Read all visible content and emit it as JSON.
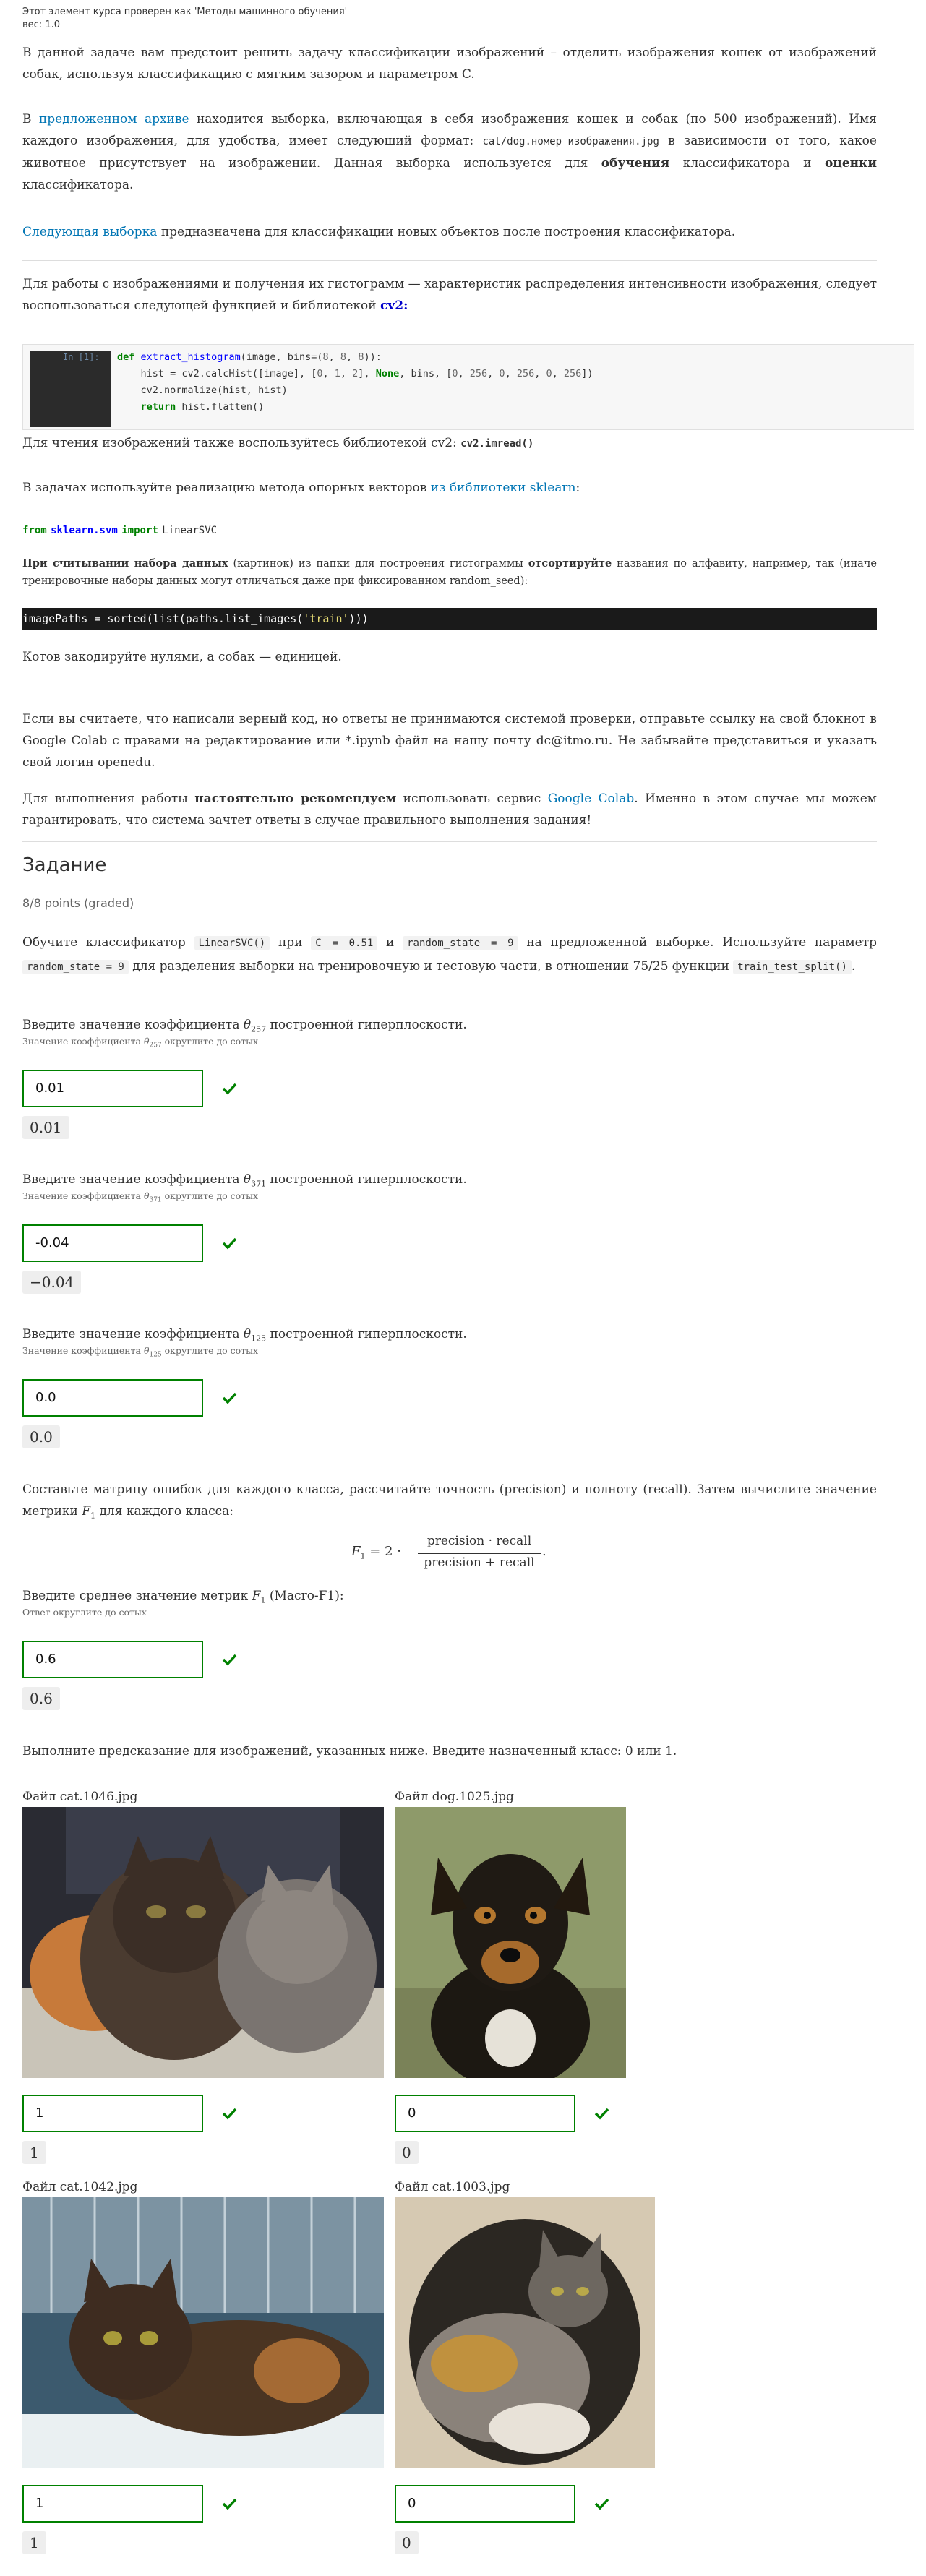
{
  "meta": {
    "verified_line": "Этот элемент курса проверен как 'Методы машинного обучения'",
    "weight": "вес: 1.0"
  },
  "intro": {
    "p1": "В данной задаче вам предстоит решить задачу классификации изображений – отделить изображения кошек от изображений собак, используя классификацию с мягким зазором и параметром C.",
    "p2_link": "предложенном архиве",
    "p2_a": "В ",
    "p2_b": " находится выборка, включающая в себя изображения кошек и собак (по 500 изображений). Имя каждого изображения, для удобства, имеет следующий формат: ",
    "p2_code": "cat/dog.номер_изображения.jpg",
    "p2_c": " в зависимости от того, какое животное присутствует на изображении. Данная выборка используется для ",
    "p2_bold1": "обучения",
    "p2_d": " классификатора и ",
    "p2_bold2": "оценки",
    "p2_e": " классификатора.",
    "p3_link": "Следующая выборка",
    "p3_rest": " предназначена для классификации новых объектов после построения классификатора.",
    "p4": "Для работы с изображениями и получения их гистограмм — характеристик распределения интенсивности изображения, следует воспользоваться следующей функцией и библиотекой ",
    "p4_lib": "cv2:",
    "code_prompt": "In [1]:",
    "code_lines": [
      "def extract_histogram(image, bins=(8, 8, 8)):",
      "    hist = cv2.calcHist([image], [0, 1, 2], None, bins, [0, 256, 0, 256, 0, 256])",
      "    cv2.normalize(hist, hist)",
      "    return hist.flatten()"
    ],
    "p5": "Для чтения изображений также воспользуйтесь библиотекой cv2: ",
    "p5_code": "cv2.imread()",
    "p6_a": "В задачах используйте реализацию метода опорных векторов ",
    "p6_link": "из библиотеки sklearn",
    "p6_b": ":",
    "import_from": "from",
    "import_mod": "sklearn.svm",
    "import_kw": "import",
    "import_name": "LinearSVC",
    "p7_bold1": "При считывании набора данных",
    "p7_a": " (картинок) из папки для построения гистограммы ",
    "p7_bold2": "отсортируйте",
    "p7_b": " названия по алфавиту, например, так (иначе тренировочные наборы данных могут отличаться даже при фиксированном random_seed):",
    "dark_code_a": "imagePaths = sorted(list(paths.list_images(",
    "dark_code_str": "'train'",
    "dark_code_b": ")))",
    "p8": "Котов закодируйте нулями, а собак — единицей.",
    "p9": "Если вы считаете, что написали верный код, но ответы не принимаются системой проверки,  отправьте ссылку на свой блокнот в Google Colab с правами на редактирование или *.ipynb файл на нашу почту dc@itmo.ru. Не забывайте представиться и указать свой логин openedu.",
    "p10_a": "Для выполнения работы ",
    "p10_bold": "настоятельно рекомендуем",
    "p10_b": " использовать сервис ",
    "p10_link": "Google Colab",
    "p10_c": ". Именно в этом случае мы можем гарантировать, что система зачтет ответы в случае правильного выполнения задания!"
  },
  "task": {
    "heading": "Задание",
    "points": "8/8 points (graded)",
    "desc_a": "Обучите классификатор ",
    "desc_code1": "LinearSVC()",
    "desc_b": " при ",
    "desc_code2": "C = 0.51",
    "desc_c": " и ",
    "desc_code3": "random_state = 9",
    "desc_d": " на предложенной выборке. Используйте параметр ",
    "desc_code4": "random_state = 9",
    "desc_e": " для разделения выборки на тренировочную и тестовую части, в отношении 75/25 функции ",
    "desc_code5": "train_test_split()",
    "desc_f": "."
  },
  "questions": [
    {
      "prompt_a": "Введите значение коэффициента ",
      "theta": "θ",
      "sub": "257",
      "prompt_b": " построенной гиперплоскости.",
      "hint_a": "Значение коэффициента ",
      "hint_b": " округлите до сотых",
      "value": "0.01",
      "echo": "0.01"
    },
    {
      "prompt_a": "Введите значение коэффициента ",
      "theta": "θ",
      "sub": "371",
      "prompt_b": " построенной гиперплоскости.",
      "hint_a": "Значение коэффициента ",
      "hint_b": " округлите до сотых",
      "value": "-0.04",
      "echo": "−0.04"
    },
    {
      "prompt_a": "Введите значение коэффициента ",
      "theta": "θ",
      "sub": "125",
      "prompt_b": " построенной гиперплоскости.",
      "hint_a": "Значение коэффициента ",
      "hint_b": " округлите до сотых",
      "value": "0.0",
      "echo": "0.0"
    }
  ],
  "f1": {
    "intro": "Составьте матрицу ошибок для каждого класса, рассчитайте точность (precision) и полноту (recall). Затем вычислите значение метрики ",
    "intro_b": " для каждого класса:",
    "formula_lhs": "F",
    "formula_sub": "1",
    "formula_eq": "= 2 ·",
    "formula_num": "precision · recall",
    "formula_den": "precision + recall",
    "prompt_a": "Введите среднее значение метрик ",
    "prompt_b": " (Macro-F1):",
    "hint": "Ответ округлите до сотых",
    "value": "0.6",
    "echo": "0.6"
  },
  "predict": {
    "intro": "Выполните предсказание для изображений, указанных ниже. Введите назначенный класс: 0 или 1.",
    "files": [
      {
        "label": "Файл cat.1046.jpg",
        "value": "1",
        "echo": "1"
      },
      {
        "label": "Файл dog.1025.jpg",
        "value": "0",
        "echo": "0"
      },
      {
        "label": "Файл cat.1042.jpg",
        "value": "1",
        "echo": "1"
      },
      {
        "label": "Файл cat.1003.jpg",
        "value": "0",
        "echo": "0"
      }
    ]
  },
  "colors": {
    "accent": "#0075b4",
    "correct": "#008100",
    "code_bg": "#1a1a1a"
  },
  "icons": {
    "correct": "checkmark-icon"
  }
}
